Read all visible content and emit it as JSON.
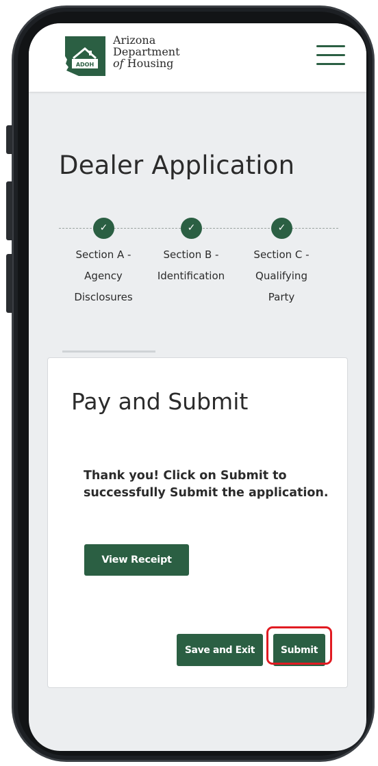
{
  "brand": {
    "logo_abbrev": "ADOH",
    "name_line1": "Arizona",
    "name_line2": "Department",
    "name_line3_italic": "of",
    "name_line3_rest": " Housing"
  },
  "menu": {
    "icon": "hamburger-menu-icon"
  },
  "page": {
    "title": "Dealer Application"
  },
  "steps": [
    {
      "icon": "✓",
      "status": "complete",
      "label_lines": [
        "Section A -",
        "Agency",
        "Disclosures"
      ]
    },
    {
      "icon": "✓",
      "status": "complete",
      "label_lines": [
        "Section B -",
        "Identification"
      ]
    },
    {
      "icon": "✓",
      "status": "complete",
      "label_lines": [
        "Section C -",
        "Qualifying",
        "Party"
      ]
    }
  ],
  "card": {
    "title": "Pay and Submit",
    "message": "Thank you! Click on Submit to successfully Submit the application.",
    "view_receipt_label": "View Receipt",
    "save_exit_label": "Save and Exit",
    "submit_label": "Submit"
  },
  "colors": {
    "brand_green": "#2b5f43",
    "highlight_red": "#e11b22",
    "background": "#eceef0"
  }
}
